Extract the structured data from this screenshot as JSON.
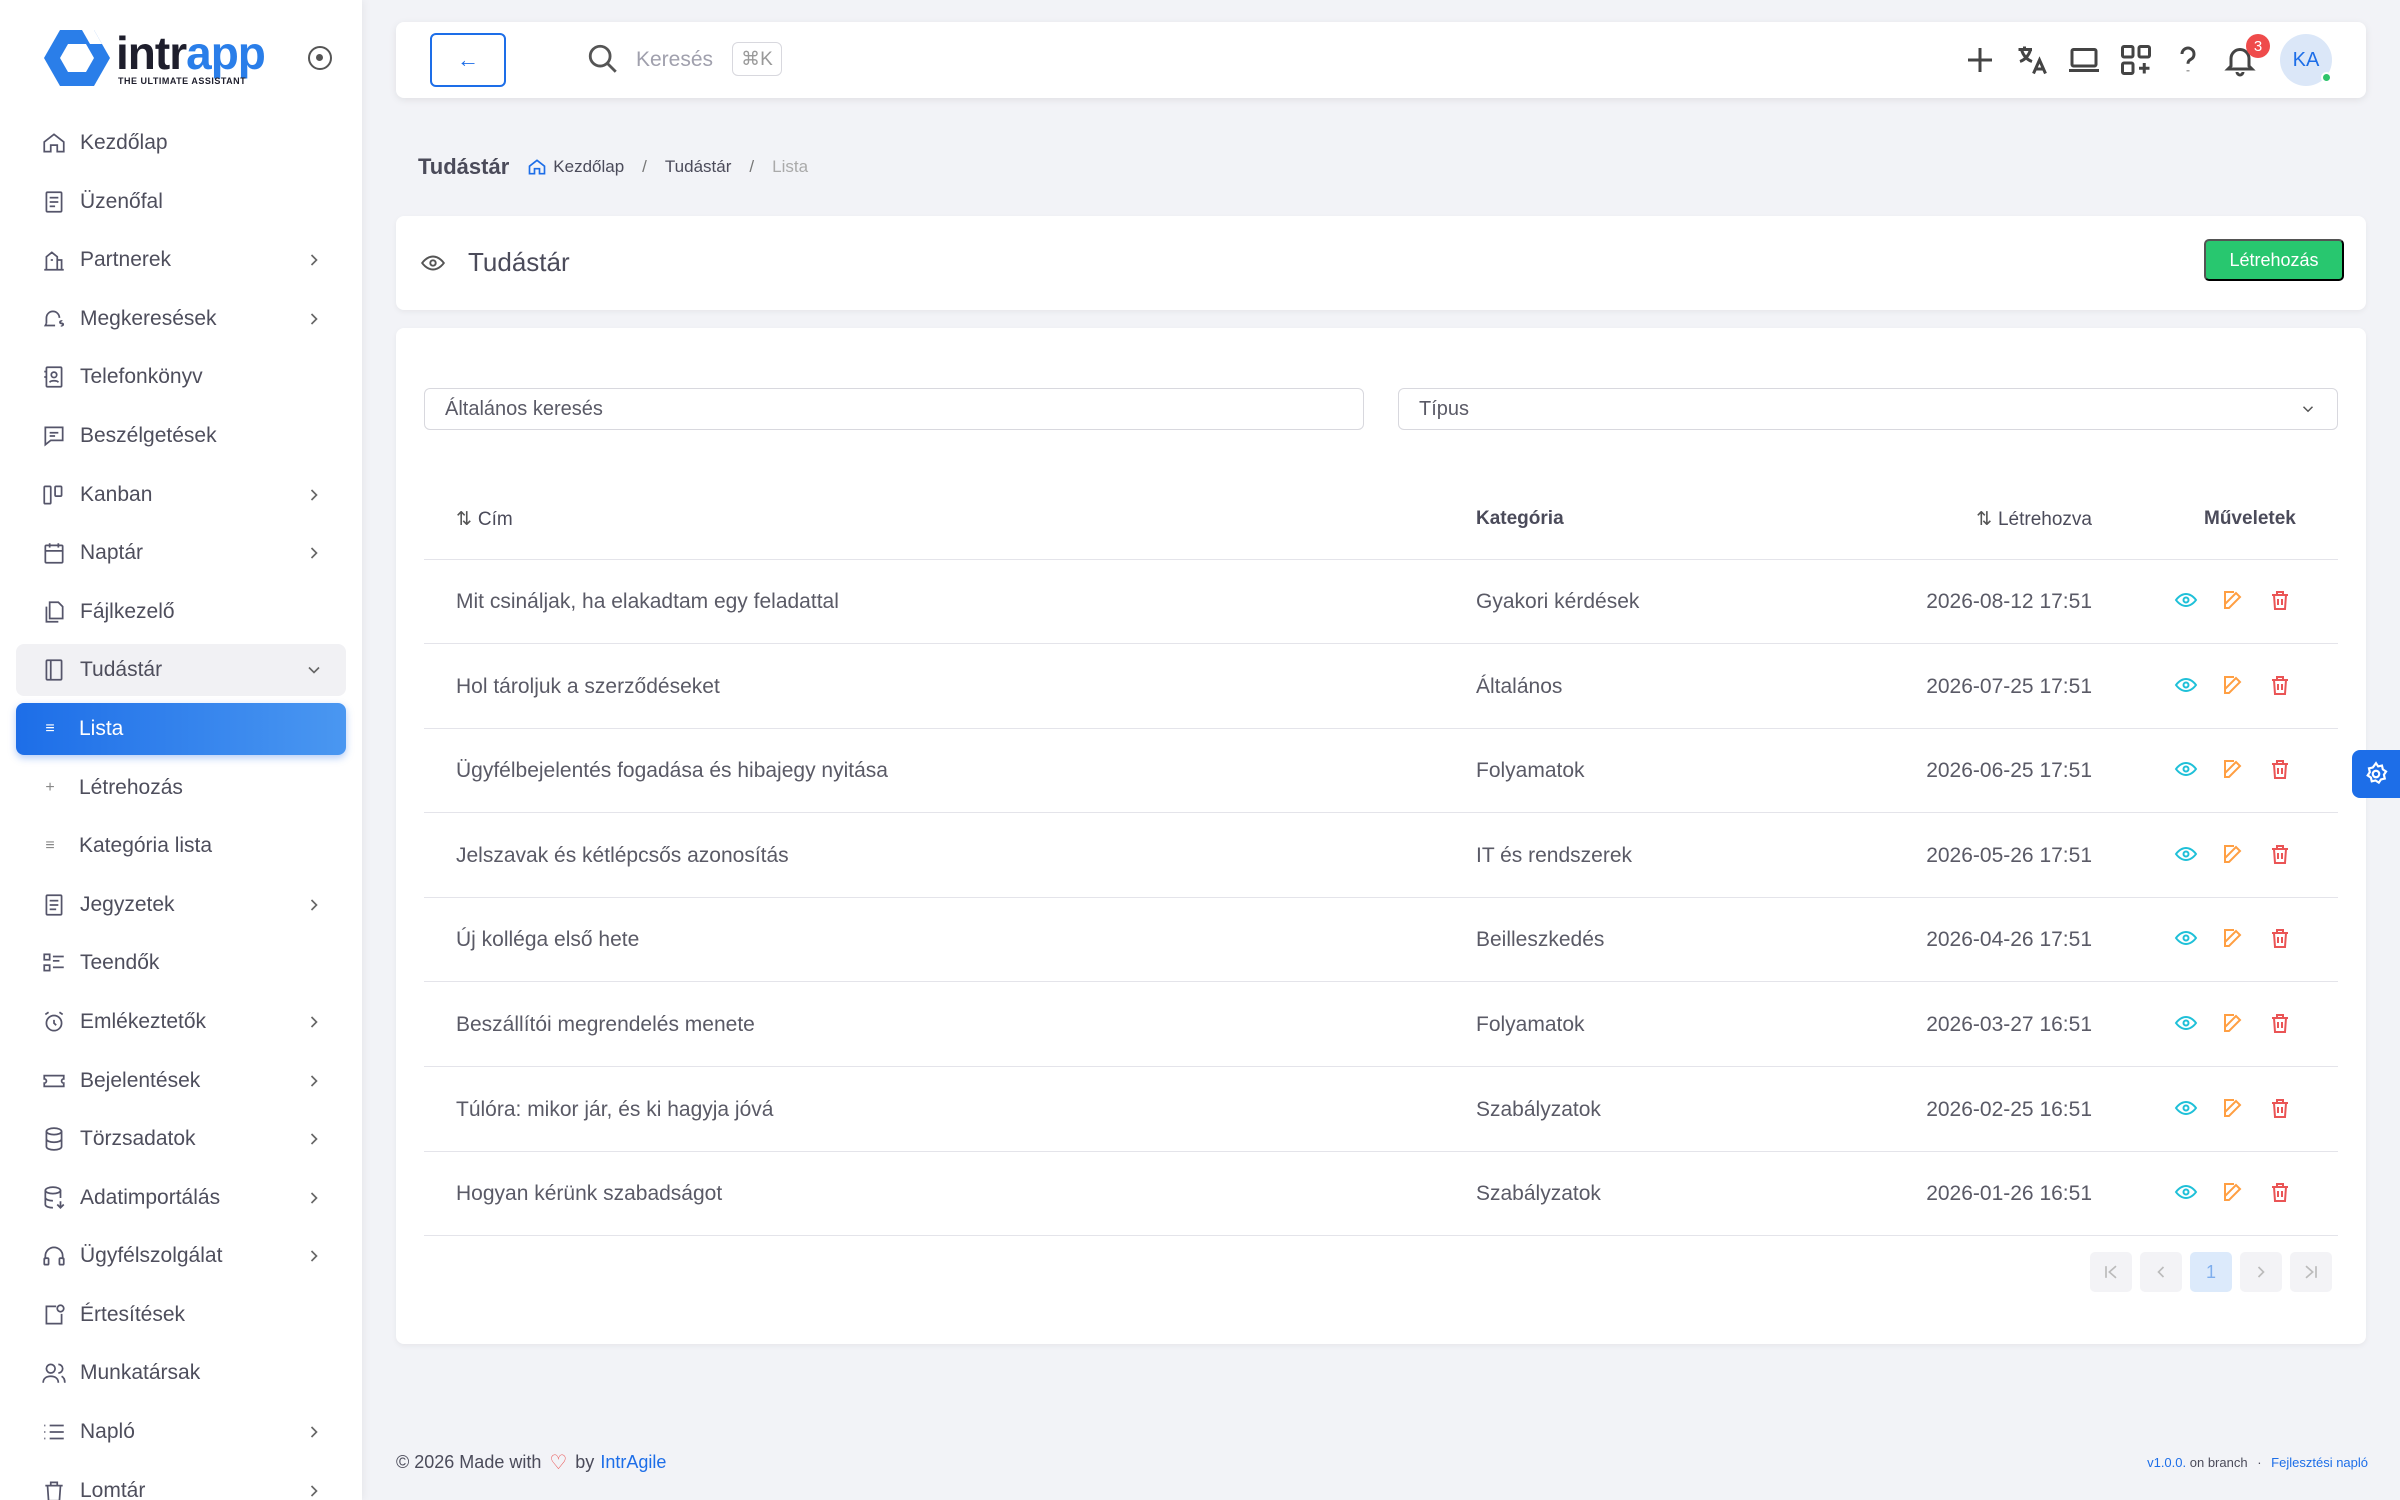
{
  "brand": {
    "logo_word_a": "intr",
    "logo_word_b": "app",
    "logo_sub": "THE ULTIMATE ASSISTANT"
  },
  "sidebar": {
    "items": [
      {
        "label": "Kezdőlap",
        "icon": "home-icon",
        "chevron": false
      },
      {
        "label": "Üzenőfal",
        "icon": "board-icon",
        "chevron": false
      },
      {
        "label": "Partnerek",
        "icon": "partners-icon",
        "chevron": true
      },
      {
        "label": "Megkeresések",
        "icon": "bell-dollar-icon",
        "chevron": true
      },
      {
        "label": "Telefonkönyv",
        "icon": "phonebook-icon",
        "chevron": false
      },
      {
        "label": "Beszélgetések",
        "icon": "chat-icon",
        "chevron": false
      },
      {
        "label": "Kanban",
        "icon": "kanban-icon",
        "chevron": true
      },
      {
        "label": "Naptár",
        "icon": "calendar-icon",
        "chevron": true
      },
      {
        "label": "Fájlkezelő",
        "icon": "files-icon",
        "chevron": false
      },
      {
        "label": "Tudástár",
        "icon": "book-icon",
        "chevron": true,
        "open": true
      },
      {
        "label": "Lista",
        "sub": true,
        "bullet": "≡",
        "active": true
      },
      {
        "label": "Létrehozás",
        "sub": true,
        "bullet": "+"
      },
      {
        "label": "Kategória lista",
        "sub": true,
        "bullet": "≡"
      },
      {
        "label": "Jegyzetek",
        "icon": "notes-icon",
        "chevron": true
      },
      {
        "label": "Teendők",
        "icon": "todo-icon",
        "chevron": false
      },
      {
        "label": "Emlékeztetők",
        "icon": "alarm-icon",
        "chevron": true
      },
      {
        "label": "Bejelentések",
        "icon": "ticket-icon",
        "chevron": true
      },
      {
        "label": "Törzsadatok",
        "icon": "database-icon",
        "chevron": true
      },
      {
        "label": "Adatimportálás",
        "icon": "db-import-icon",
        "chevron": true
      },
      {
        "label": "Ügyfélszolgálat",
        "icon": "headset-icon",
        "chevron": true
      },
      {
        "label": "Értesítések",
        "icon": "notification-icon",
        "chevron": false
      },
      {
        "label": "Munkatársak",
        "icon": "users-icon",
        "chevron": false
      },
      {
        "label": "Napló",
        "icon": "list-icon",
        "chevron": true
      },
      {
        "label": "Lomtár",
        "icon": "trash-icon",
        "chevron": true
      }
    ]
  },
  "topbar": {
    "back_label": "←",
    "search_placeholder": "Keresés",
    "shortcut": "⌘K",
    "notification_count": "3",
    "avatar_initials": "KA"
  },
  "breadcrumb": {
    "title": "Tudástár",
    "home": "Kezdőlap",
    "section": "Tudástár",
    "current": "Lista"
  },
  "header": {
    "title": "Tudástár",
    "create_label": "Létrehozás"
  },
  "filters": {
    "search_placeholder": "Általános keresés",
    "type_placeholder": "Típus"
  },
  "table": {
    "columns": {
      "title": "Cím",
      "category": "Kategória",
      "created": "Létrehozva",
      "actions": "Műveletek"
    },
    "rows": [
      {
        "title": "Mit csináljak, ha elakadtam egy feladattal",
        "category": "Gyakori kérdések",
        "created": "2026-08-12 17:51"
      },
      {
        "title": "Hol tároljuk a szerződéseket",
        "category": "Általános",
        "created": "2026-07-25 17:51"
      },
      {
        "title": "Ügyfélbejelentés fogadása és hibajegy nyitása",
        "category": "Folyamatok",
        "created": "2026-06-25 17:51"
      },
      {
        "title": "Jelszavak és kétlépcsős azonosítás",
        "category": "IT és rendszerek",
        "created": "2026-05-26 17:51"
      },
      {
        "title": "Új kolléga első hete",
        "category": "Beilleszkedés",
        "created": "2026-04-26 17:51"
      },
      {
        "title": "Beszállítói megrendelés menete",
        "category": "Folyamatok",
        "created": "2026-03-27 16:51"
      },
      {
        "title": "Túlóra: mikor jár, és ki hagyja jóvá",
        "category": "Szabályzatok",
        "created": "2026-02-25 16:51"
      },
      {
        "title": "Hogyan kérünk szabadságot",
        "category": "Szabályzatok",
        "created": "2026-01-26 16:51"
      }
    ]
  },
  "pagination": {
    "current_page": "1"
  },
  "footer": {
    "left_prefix": "© 2026 Made with",
    "left_by": "by",
    "brand": "IntrAgile",
    "version": "v1.0.0.",
    "branch_text": "on branch",
    "dot": "·",
    "dev_log": "Fejlesztési napló"
  }
}
